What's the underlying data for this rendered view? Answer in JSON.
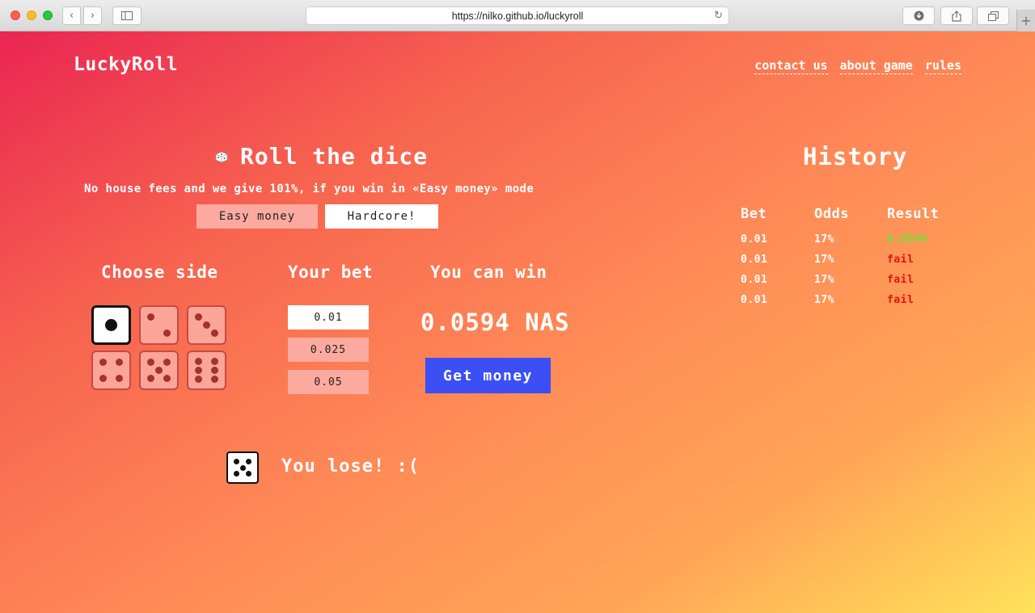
{
  "browser": {
    "url": "https://nilko.github.io/luckyroll",
    "icons": [
      "back-icon",
      "forward-icon",
      "sidebar-icon",
      "reload-icon",
      "download-icon",
      "share-icon",
      "tabs-icon",
      "new-tab-icon"
    ]
  },
  "header": {
    "logo": "LuckyRoll",
    "nav": [
      "contact us",
      "about game",
      "rules"
    ]
  },
  "game": {
    "title": "Roll the dice",
    "subtitle": "No house fees and we give 101%, if you win in «Easy money» mode",
    "modes": {
      "easy": "Easy money",
      "hardcore": "Hardcore!",
      "selected": "Easy money"
    },
    "choose_side": {
      "heading": "Choose side",
      "sides": [
        1,
        2,
        3,
        4,
        5,
        6
      ],
      "selected": 1
    },
    "bet": {
      "heading": "Your bet",
      "options": [
        "0.01",
        "0.025",
        "0.05"
      ],
      "selected": "0.01"
    },
    "win": {
      "heading": "You can win",
      "amount": "0.0594 NAS",
      "button": "Get money"
    },
    "result": {
      "rolled": 5,
      "text": "You lose! :("
    }
  },
  "history": {
    "title": "History",
    "columns": [
      "Bet",
      "Odds",
      "Result"
    ],
    "rows": [
      {
        "bet": "0.01",
        "odds": "17%",
        "result": "0.0594",
        "status": "win"
      },
      {
        "bet": "0.01",
        "odds": "17%",
        "result": "fail",
        "status": "fail"
      },
      {
        "bet": "0.01",
        "odds": "17%",
        "result": "fail",
        "status": "fail"
      },
      {
        "bet": "0.01",
        "odds": "17%",
        "result": "fail",
        "status": "fail"
      }
    ]
  },
  "colors": {
    "gradient_start": "#ea2552",
    "gradient_end": "#ffe25a",
    "get_money_button": "#3b4ff5",
    "win_text": "#3dff27",
    "fail_text": "#e8120e"
  }
}
